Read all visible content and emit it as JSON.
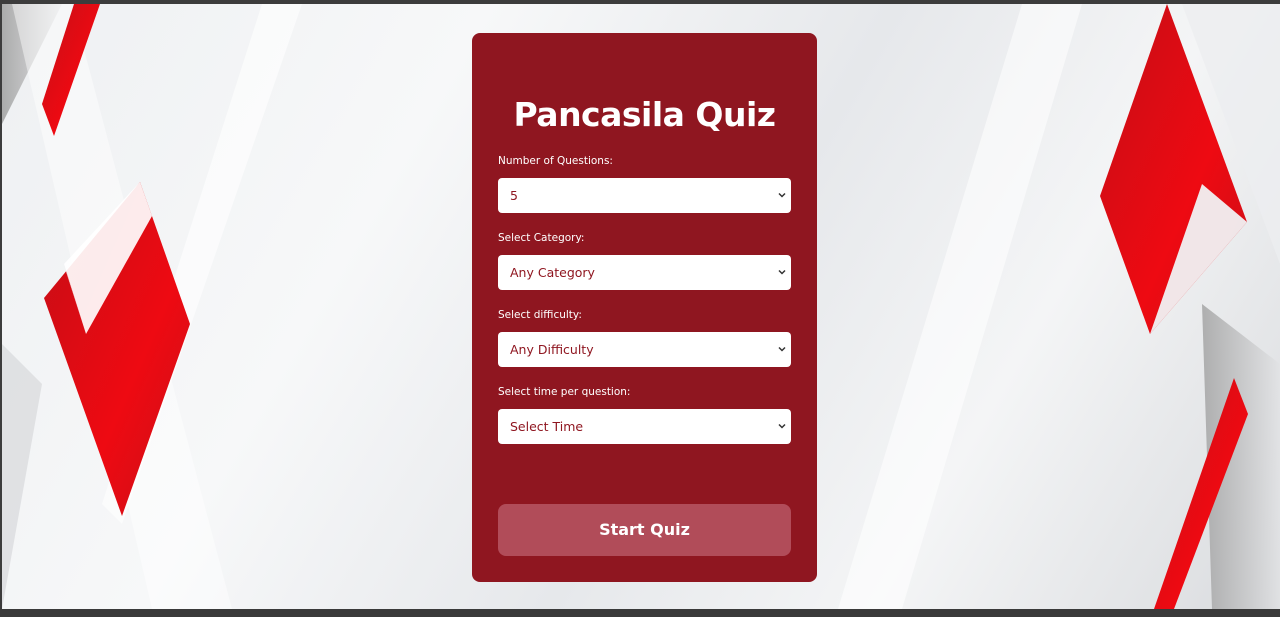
{
  "quiz": {
    "title": "Pancasila Quiz",
    "fields": [
      {
        "label": "Number of Questions:",
        "selected": "5"
      },
      {
        "label": "Select Category:",
        "selected": "Any Category"
      },
      {
        "label": "Select difficulty:",
        "selected": "Any Difficulty"
      },
      {
        "label": "Select time per question:",
        "selected": "Select Time"
      }
    ],
    "start_label": "Start Quiz"
  },
  "colors": {
    "card": "#8f1620",
    "button": "#b14c59",
    "accent_red": "#e8101a",
    "background": "#eef0f2"
  },
  "icons": {
    "select_arrow": "chevron-down-icon"
  }
}
